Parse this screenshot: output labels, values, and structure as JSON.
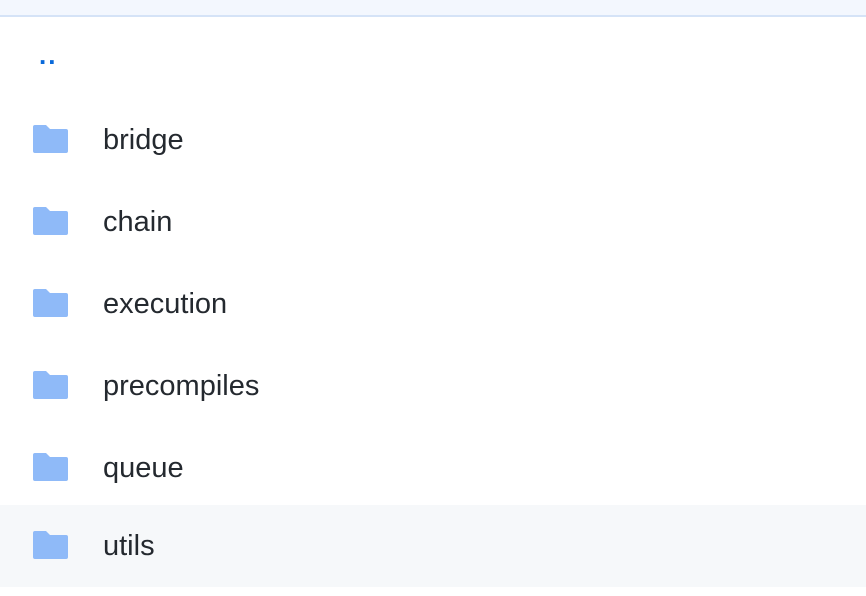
{
  "top_bar": {},
  "files": {
    "parent": {
      "label": ".."
    },
    "folders": [
      {
        "name": "bridge",
        "icon": "folder-icon"
      },
      {
        "name": "chain",
        "icon": "folder-icon"
      },
      {
        "name": "execution",
        "icon": "folder-icon"
      },
      {
        "name": "precompiles",
        "icon": "folder-icon"
      },
      {
        "name": "queue",
        "icon": "folder-icon"
      },
      {
        "name": "utils",
        "icon": "folder-icon"
      }
    ],
    "hovered_folder": "utils"
  },
  "colors": {
    "folder_icon": "#8fbaf8",
    "parent_link": "#0969da",
    "text": "#24292f",
    "hover_row": "#f6f8fa",
    "top_strip": "#f3f7fe"
  }
}
